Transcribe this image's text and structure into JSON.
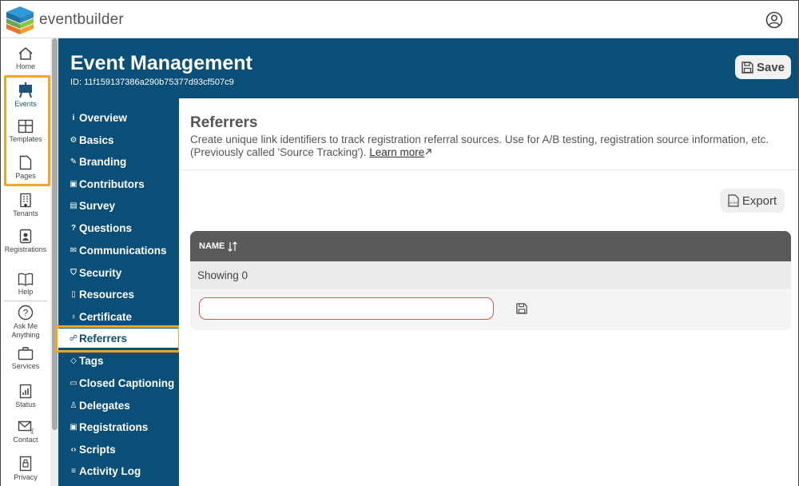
{
  "app": {
    "brand": "eventbuilder"
  },
  "leftnav": {
    "items": [
      {
        "label": "Home",
        "icon": "home-icon"
      },
      {
        "label": "Events",
        "icon": "easel-icon",
        "active": true
      },
      {
        "label": "Templates",
        "icon": "layout-icon"
      },
      {
        "label": "Pages",
        "icon": "page-icon"
      },
      {
        "label": "Tenants",
        "icon": "building-icon"
      },
      {
        "label": "Registrations",
        "icon": "badge-icon"
      },
      {
        "label": "Help",
        "icon": "book-icon"
      },
      {
        "label": "Ask Me",
        "label2": "Anything",
        "icon": "question-icon"
      },
      {
        "label": "Services",
        "icon": "briefcase-icon"
      },
      {
        "label": "Status",
        "icon": "status-icon"
      },
      {
        "label": "Contact",
        "icon": "mail-icon"
      },
      {
        "label": "Privacy",
        "icon": "lock-icon"
      }
    ]
  },
  "header": {
    "title": "Event Management",
    "id_text": "ID: 11f159137386a290b75377d93cf507c9",
    "save_label": "Save"
  },
  "subnav": {
    "items": [
      {
        "label": "Overview",
        "glyph": "i"
      },
      {
        "label": "Basics",
        "glyph": "⚙"
      },
      {
        "label": "Branding",
        "glyph": "✎"
      },
      {
        "label": "Contributors",
        "glyph": "▣"
      },
      {
        "label": "Survey",
        "glyph": "▤"
      },
      {
        "label": "Questions",
        "glyph": "?"
      },
      {
        "label": "Communications",
        "glyph": "✉"
      },
      {
        "label": "Security",
        "glyph": "⛉"
      },
      {
        "label": "Resources",
        "glyph": "▯"
      },
      {
        "label": "Certificate",
        "glyph": "♁"
      },
      {
        "label": "Referrers",
        "glyph": "☍",
        "active": true
      },
      {
        "label": "Tags",
        "glyph": "◇"
      },
      {
        "label": "Closed Captioning",
        "glyph": "▭"
      },
      {
        "label": "Delegates",
        "glyph": "♙"
      },
      {
        "label": "Registrations",
        "glyph": "▣"
      },
      {
        "label": "Scripts",
        "glyph": "‹›"
      },
      {
        "label": "Activity Log",
        "glyph": "≡"
      }
    ]
  },
  "main": {
    "title": "Referrers",
    "description": "Create unique link identifiers to track registration referral sources. Use for A/B testing, registration source information, etc. (Previously called 'Source Tracking').",
    "learn_more": "Learn more",
    "export_label": "Export",
    "column_name": "NAME",
    "showing": "Showing 0",
    "input_value": ""
  },
  "colors": {
    "brand_blue": "#0a4f78",
    "highlight": "#f5a623",
    "table_header": "#5a5a5a",
    "error_border": "#d9534f"
  }
}
